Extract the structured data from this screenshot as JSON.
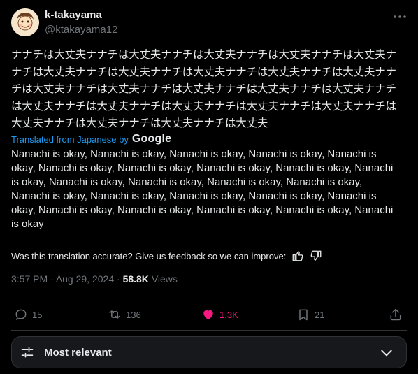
{
  "author": {
    "name": "k-takayama",
    "handle": "@ktakayama12"
  },
  "post": {
    "text": "ナナチは大丈夫ナナチは大丈夫ナナチは大丈夫ナナチは大丈夫ナナチは大丈夫ナナチは大丈夫ナナチは大丈夫ナナチは大丈夫ナナチは大丈夫ナナチは大丈夫ナナチは大丈夫ナナチは大丈夫ナナチは大丈夫ナナチは大丈夫ナナチは大丈夫ナナチは大丈夫ナナチは大丈夫ナナチは大丈夫ナナチは大丈夫ナナチは大丈夫ナナチは大丈夫ナナチは大丈夫ナナチは大丈夫ナナチは大丈夫",
    "translated_from": "Translated from Japanese by",
    "translator": "Google",
    "translation": "Nanachi is okay, Nanachi is okay, Nanachi is okay, Nanachi is okay, Nanachi is okay, Nanachi is okay, Nanachi is okay, Nanachi is okay, Nanachi is okay, Nanachi is okay, Nanachi is okay, Nanachi is okay, Nanachi is okay, Nanachi is okay, Nanachi is okay, Nanachi is okay, Nanachi is okay, Nanachi is okay, Nanachi is okay, Nanachi is okay, Nanachi is okay, Nanachi is okay, Nanachi is okay, Nanachi is okay",
    "feedback": "Was this translation accurate? Give us feedback so we can improve:",
    "time": "3:57 PM",
    "date": "Aug 29, 2024",
    "views_count": "58.8K",
    "views_label": "Views"
  },
  "actions": {
    "replies": "15",
    "reposts": "136",
    "likes": "1.3K",
    "bookmarks": "21"
  },
  "sort": {
    "label": "Most relevant"
  },
  "colors": {
    "background": "#000000",
    "link": "#1d9bf0",
    "like": "#f91880",
    "muted": "#71767b"
  }
}
